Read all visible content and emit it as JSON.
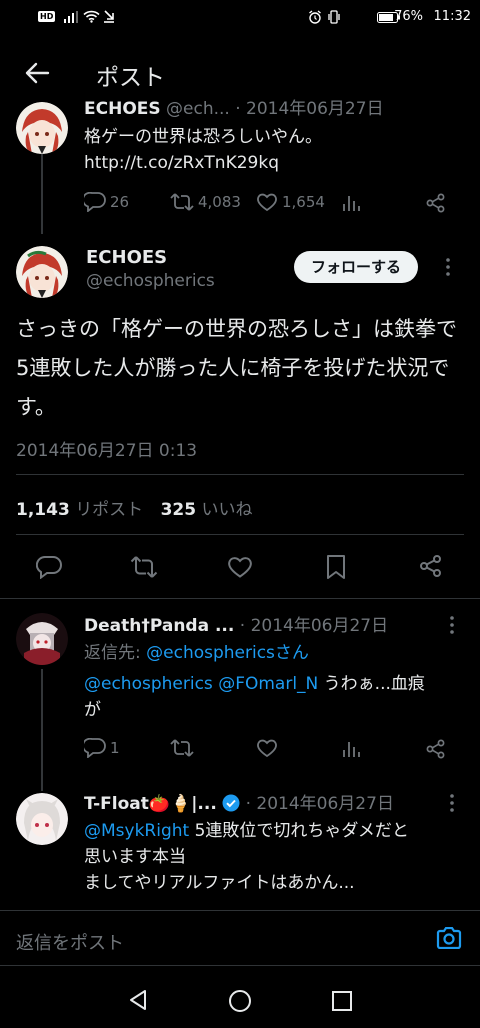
{
  "status_bar": {
    "hd": "HD",
    "battery": "76%",
    "time": "11:32"
  },
  "header": {
    "title": "ポスト"
  },
  "parent_tweet": {
    "name": "ECHOES",
    "handle_partial": "@ech...",
    "date": "· 2014年06月27日",
    "text": "格ゲーの世界は恐ろしいやん。",
    "link": "http://t.co/zRxTnK29kq",
    "replies": "26",
    "retweets": "4,083",
    "likes": "1,654"
  },
  "main_tweet": {
    "name": "ECHOES",
    "handle": "@echospherics",
    "follow_label": "フォローする",
    "text": "さっきの「格ゲーの世界の恐ろしさ」は鉄拳で5連敗した人が勝った人に椅子を投げた状況です。",
    "timestamp": "2014年06月27日 0:13",
    "reposts_count": "1,143",
    "reposts_label": "リポスト",
    "likes_count": "325",
    "likes_label": "いいね"
  },
  "reply1": {
    "name": "Death†Panda ...",
    "date": "· 2014年06月27日",
    "reply_to_prefix": "返信先: ",
    "reply_to_handle": "@echosphericsさん",
    "mention1": "@echospherics",
    "mention2": "@FOmarl_N",
    "text_line1": " うわぁ...血痕",
    "text_line2": "が",
    "replies": "1"
  },
  "reply2": {
    "name": "T-Float🍅🍦|...",
    "date": "· 2014年06月27日",
    "mention": "@MsykRight",
    "text_line1": " 5連敗位で切れちゃダメだと",
    "text_line2": "思います本当",
    "text_line3": "ましてやリアルファイトはあかん..."
  },
  "reply_bar": {
    "placeholder": "返信をポスト"
  },
  "colors": {
    "background": "#000000",
    "text": "#e7e9ea",
    "secondary": "#71767b",
    "link": "#1d9bf0",
    "divider": "#2f3336",
    "verified": "#1d9bf0"
  }
}
